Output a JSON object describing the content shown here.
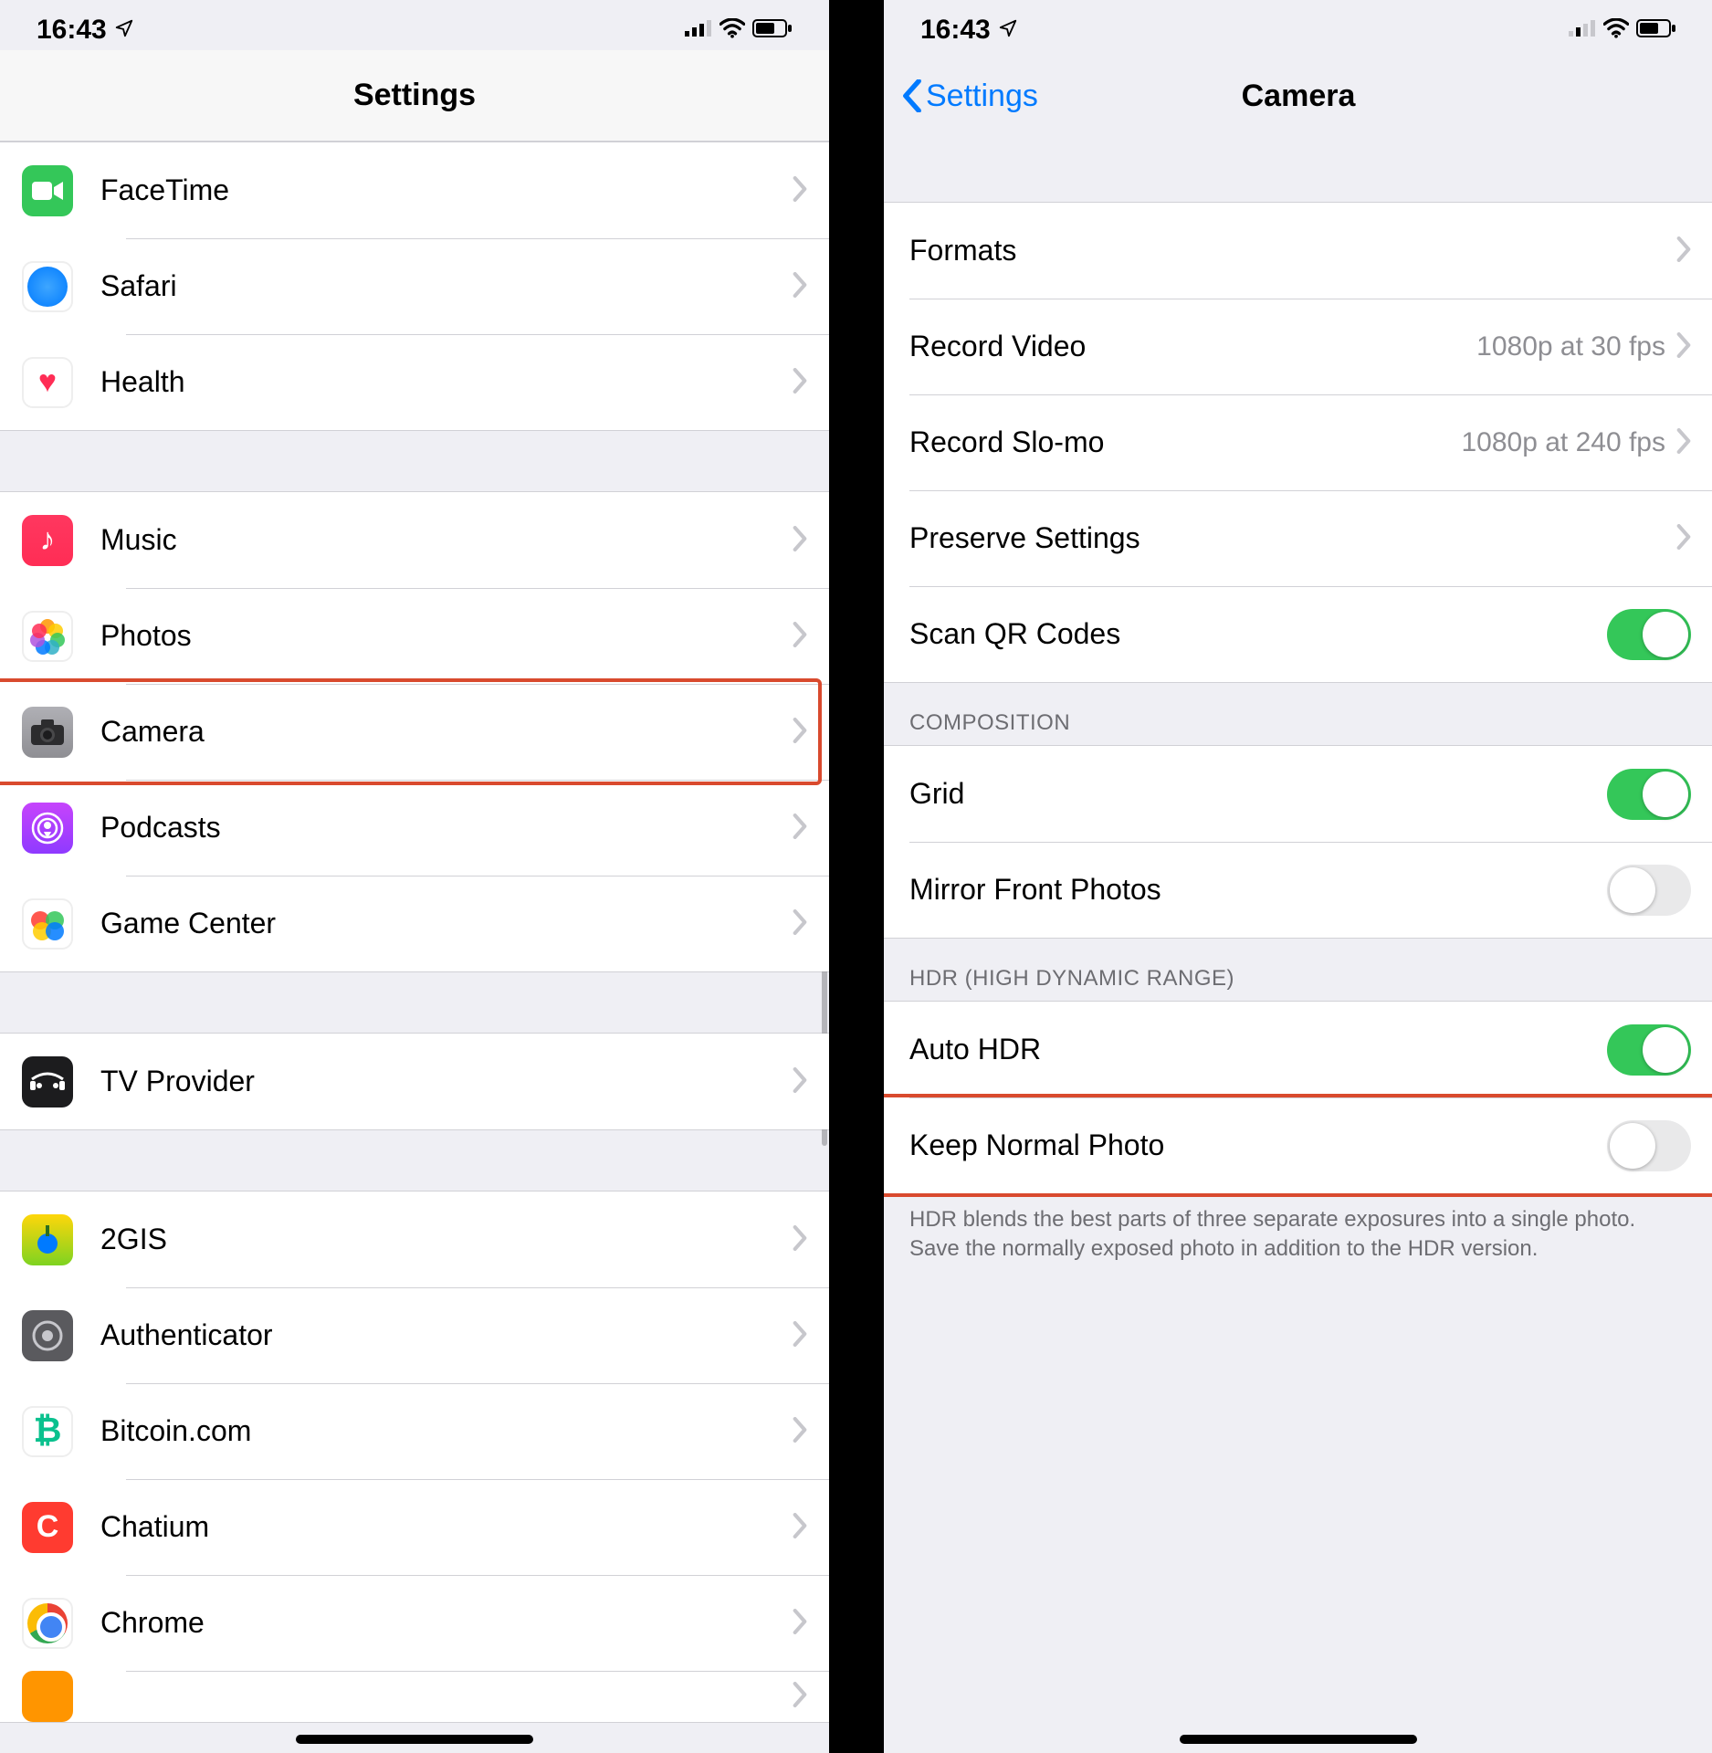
{
  "status": {
    "time": "16:43"
  },
  "left": {
    "title": "Settings",
    "groups": [
      {
        "rows": [
          {
            "id": "facetime",
            "label": "FaceTime"
          },
          {
            "id": "safari",
            "label": "Safari"
          },
          {
            "id": "health",
            "label": "Health"
          }
        ]
      },
      {
        "rows": [
          {
            "id": "music",
            "label": "Music"
          },
          {
            "id": "photos",
            "label": "Photos"
          },
          {
            "id": "camera",
            "label": "Camera",
            "highlight": true
          },
          {
            "id": "podcasts",
            "label": "Podcasts"
          },
          {
            "id": "gamecenter",
            "label": "Game Center"
          }
        ]
      },
      {
        "rows": [
          {
            "id": "tv",
            "label": "TV Provider"
          }
        ]
      },
      {
        "rows": [
          {
            "id": "2gis",
            "label": "2GIS"
          },
          {
            "id": "auth",
            "label": "Authenticator"
          },
          {
            "id": "btc",
            "label": "Bitcoin.com"
          },
          {
            "id": "chatium",
            "label": "Chatium"
          },
          {
            "id": "chrome",
            "label": "Chrome"
          },
          {
            "id": "last",
            "label": ""
          }
        ]
      }
    ]
  },
  "right": {
    "back": "Settings",
    "title": "Camera",
    "sections": [
      {
        "header": null,
        "rows": [
          {
            "id": "formats",
            "label": "Formats",
            "type": "disclosure"
          },
          {
            "id": "recvideo",
            "label": "Record Video",
            "type": "disclosure",
            "detail": "1080p at 30 fps"
          },
          {
            "id": "recslomo",
            "label": "Record Slo-mo",
            "type": "disclosure",
            "detail": "1080p at 240 fps"
          },
          {
            "id": "preserve",
            "label": "Preserve Settings",
            "type": "disclosure"
          },
          {
            "id": "qrcodes",
            "label": "Scan QR Codes",
            "type": "toggle",
            "on": true
          }
        ]
      },
      {
        "header": "COMPOSITION",
        "rows": [
          {
            "id": "grid",
            "label": "Grid",
            "type": "toggle",
            "on": true
          },
          {
            "id": "mirror",
            "label": "Mirror Front Photos",
            "type": "toggle",
            "on": false
          }
        ]
      },
      {
        "header": "HDR (HIGH DYNAMIC RANGE)",
        "rows": [
          {
            "id": "autohdr",
            "label": "Auto HDR",
            "type": "toggle",
            "on": true
          },
          {
            "id": "keepnormal",
            "label": "Keep Normal Photo",
            "type": "toggle",
            "on": false,
            "highlight": true
          }
        ],
        "footer": "HDR blends the best parts of three separate exposures into a single photo. Save the normally exposed photo in addition to the HDR version."
      }
    ]
  }
}
